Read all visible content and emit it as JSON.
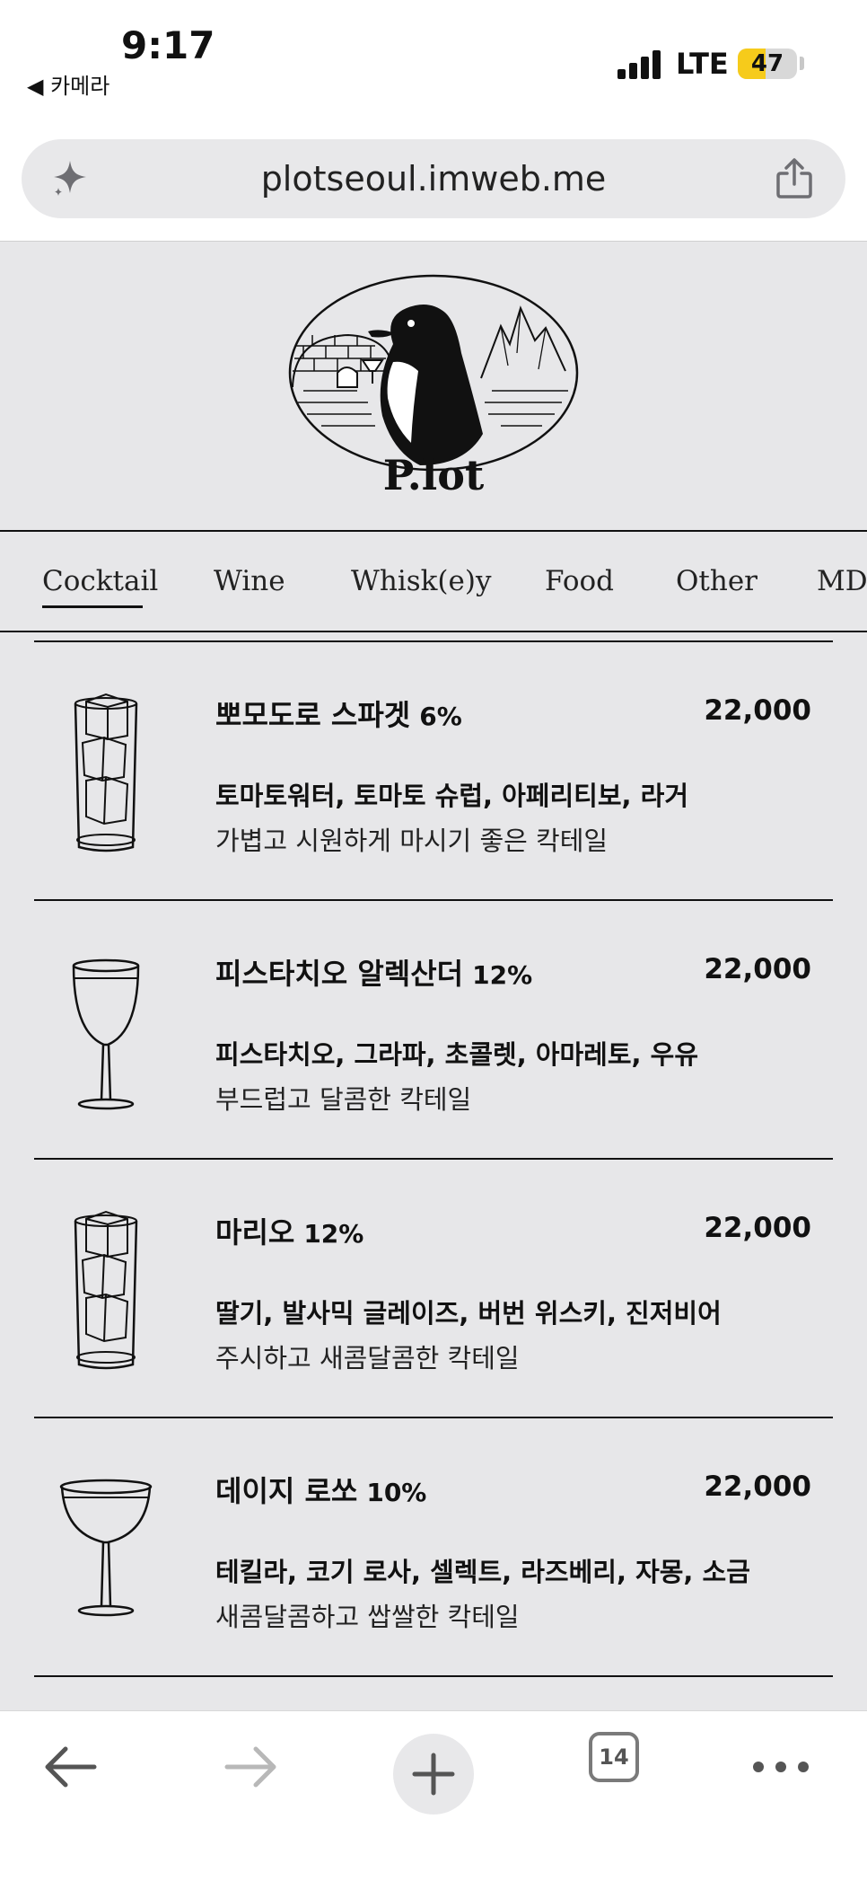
{
  "status": {
    "time": "9:17",
    "back_app": "◀ 카메라",
    "network": "LTE",
    "battery_level": "47",
    "battery_fraction": 0.47
  },
  "browser": {
    "url": "plotseoul.imweb.me",
    "tab_count": "14",
    "icons": {
      "left": "sparkle-icon",
      "right": "share-icon"
    }
  },
  "brand": {
    "logo_text": "P.lot"
  },
  "nav": {
    "tabs": [
      {
        "label": "Cocktail",
        "active": true
      },
      {
        "label": "Wine"
      },
      {
        "label": "Whisk(e)y"
      },
      {
        "label": "Food"
      },
      {
        "label": "Other"
      },
      {
        "label": "MD"
      }
    ]
  },
  "menu": [
    {
      "name": "뽀모도로 스파겟",
      "abv": "6%",
      "price": "22,000",
      "ingredients": "토마토워터, 토마토 슈럽, 아페리티보, 라거",
      "description": "가볍고 시원하게 마시기 좋은 칵테일",
      "glass": "highball-glass-icon"
    },
    {
      "name": "피스타치오 알렉산더",
      "abv": "12%",
      "price": "22,000",
      "ingredients": "피스타치오, 그라파, 초콜렛, 아마레토, 우유",
      "description": "부드럽고 달콤한 칵테일",
      "glass": "wine-glass-icon"
    },
    {
      "name": "마리오",
      "abv": "12%",
      "price": "22,000",
      "ingredients": "딸기, 발사믹 글레이즈, 버번 위스키, 진저비어",
      "description": "주시하고 새콤달콤한 칵테일",
      "glass": "highball-glass-icon"
    },
    {
      "name": "데이지 로쏘",
      "abv": "10%",
      "price": "22,000",
      "ingredients": "테킬라, 코기 로사, 셀렉트, 라즈베리, 자몽, 소금",
      "description": "새콤달콤하고 쌉쌀한 칵테일",
      "glass": "coupe-glass-icon"
    }
  ],
  "toolbar": {
    "icons": [
      "back-arrow-icon",
      "forward-arrow-icon",
      "plus-icon",
      "tabs-icon",
      "more-icon"
    ]
  }
}
